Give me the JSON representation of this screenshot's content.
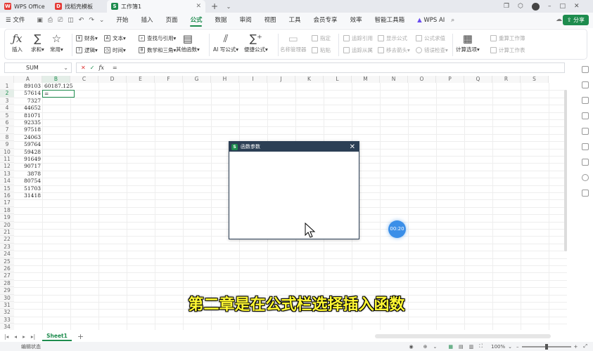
{
  "tabs": [
    {
      "label": "WPS Office",
      "icon": "wps-icon",
      "color": "#e53935"
    },
    {
      "label": "找稻壳模板",
      "icon": "docer-icon",
      "color": "#e53935"
    },
    {
      "label": "工作簿1",
      "icon": "sheet-icon",
      "color": "#1e8c4e",
      "active": true
    }
  ],
  "menu": {
    "file": "文件",
    "items": [
      "开始",
      "插入",
      "页面",
      "公式",
      "数据",
      "审阅",
      "视图",
      "工具",
      "会员专享",
      "效率",
      "智能工具箱"
    ],
    "active": "公式",
    "wps_ai": "WPS AI",
    "share": "分享"
  },
  "ribbon": {
    "insert_fn": "插入",
    "sum": "求和",
    "common": "常用",
    "finance": "财务",
    "text": "文本",
    "lookup": "查找与引用",
    "logic": "逻辑",
    "time": "时间",
    "math": "数学和三角",
    "other_fn": "其他函数",
    "ai_formula": "AI 写公式",
    "quick_formula": "便捷公式",
    "name_mgr": "名称管理器",
    "define": "指定",
    "paste": "粘贴",
    "trace_prec": "追踪引用",
    "trace_dep": "追踪从属",
    "show_formula": "显示公式",
    "remove_arrows": "移去箭头",
    "formula_eval": "公式求值",
    "error_check": "错误检查",
    "calc_options": "计算选项",
    "recalc_book": "重算工作簿",
    "calc_sheet": "计算工作表"
  },
  "formula_bar": {
    "name_box": "SUM",
    "cancel": "✕",
    "confirm": "✓",
    "fx": "fx",
    "value": "="
  },
  "grid": {
    "columns": [
      "A",
      "B",
      "C",
      "D",
      "E",
      "F",
      "G",
      "H",
      "I",
      "J",
      "K",
      "L",
      "M",
      "N",
      "O",
      "P",
      "Q",
      "R",
      "S"
    ],
    "row_count": 34,
    "col_a": [
      "89103",
      "57614",
      "7327",
      "44652",
      "81071",
      "92335",
      "97518",
      "24063",
      "59764",
      "59428",
      "91649",
      "90717",
      "3878",
      "80754",
      "51703",
      "31418"
    ],
    "b1": "60187.125",
    "b2": "="
  },
  "dialog": {
    "title": "函数参数",
    "close": "✕"
  },
  "timer": "00:20",
  "subtitle": "第二章是在公式栏选择插入函数",
  "sheet_tab": "Sheet1",
  "status": {
    "mode": "编辑状态",
    "zoom": "100%"
  }
}
